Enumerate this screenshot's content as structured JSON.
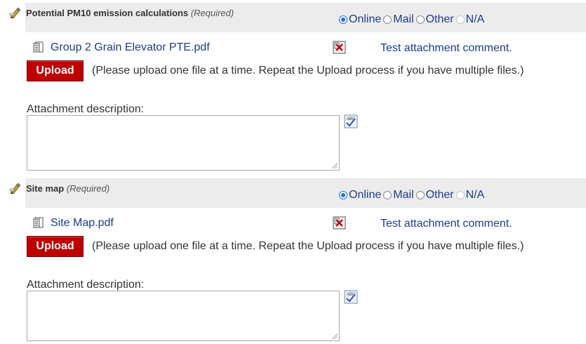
{
  "sections": [
    {
      "title": "Potential PM10 emission calculations",
      "required": "(Required)",
      "options": [
        "Online",
        "Mail",
        "Other",
        "N/A"
      ],
      "selected": "Online",
      "file_name": "Group 2 Grain Elevator PTE.pdf",
      "file_comment": "Test attachment comment.",
      "upload_label": "Upload",
      "upload_note": "(Please upload one file at a time. Repeat the Upload process if you have multiple files.)",
      "description_label": "Attachment description:",
      "description_value": ""
    },
    {
      "title": "Site map",
      "required": "(Required)",
      "options": [
        "Online",
        "Mail",
        "Other",
        "N/A"
      ],
      "selected": "Online",
      "file_name": "Site Map.pdf",
      "file_comment": "Test attachment comment.",
      "upload_label": "Upload",
      "upload_note": "(Please upload one file at a time. Repeat the Upload process if you have multiple files.)",
      "description_label": "Attachment description:",
      "description_value": ""
    }
  ],
  "icons": {
    "section": "attachment-pencil-icon",
    "file": "pdf-file-icon",
    "delete": "delete-attachment-icon",
    "spellcheck": "spellcheck-icon"
  },
  "colors": {
    "link": "#1d3c8f",
    "upload_button": "#c00000",
    "header_bg": "#ececec",
    "radio_selected": "#1a73e8"
  }
}
